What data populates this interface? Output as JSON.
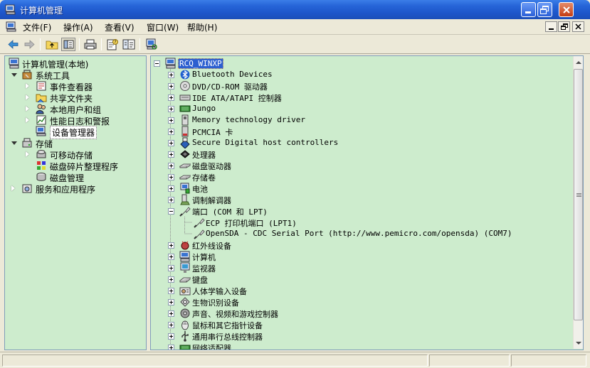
{
  "window": {
    "title": "计算机管理"
  },
  "menu": [
    "文件(F)",
    "操作(A)",
    "查看(V)",
    "窗口(W)",
    "帮助(H)"
  ],
  "left_tree": [
    {
      "label": "计算机管理(本地)"
    },
    {
      "label": "系统工具"
    },
    {
      "label": "事件查看器"
    },
    {
      "label": "共享文件夹"
    },
    {
      "label": "本地用户和组"
    },
    {
      "label": "性能日志和警报"
    },
    {
      "label": "设备管理器"
    },
    {
      "label": "存储"
    },
    {
      "label": "可移动存储"
    },
    {
      "label": "磁盘碎片整理程序"
    },
    {
      "label": "磁盘管理"
    },
    {
      "label": "服务和应用程序"
    }
  ],
  "right_tree": [
    {
      "label": "RCQ_WINXP"
    },
    {
      "label": "Bluetooth Devices"
    },
    {
      "label": "DVD/CD-ROM 驱动器"
    },
    {
      "label": "IDE ATA/ATAPI 控制器"
    },
    {
      "label": "Jungo"
    },
    {
      "label": "Memory technology driver"
    },
    {
      "label": "PCMCIA 卡"
    },
    {
      "label": "Secure Digital host controllers"
    },
    {
      "label": "处理器"
    },
    {
      "label": "磁盘驱动器"
    },
    {
      "label": "存储卷"
    },
    {
      "label": "电池"
    },
    {
      "label": "调制解调器"
    },
    {
      "label": "端口 (COM 和 LPT)"
    },
    {
      "label": "ECP 打印机端口 (LPT1)"
    },
    {
      "label": "OpenSDA - CDC Serial Port (http://www.pemicro.com/opensda) (COM7)"
    },
    {
      "label": "红外线设备"
    },
    {
      "label": "计算机"
    },
    {
      "label": "监视器"
    },
    {
      "label": "键盘"
    },
    {
      "label": "人体学输入设备"
    },
    {
      "label": "生物识别设备"
    },
    {
      "label": "声音、视频和游戏控制器"
    },
    {
      "label": "鼠标和其它指针设备"
    },
    {
      "label": "通用串行总线控制器"
    },
    {
      "label": "网络适配器"
    }
  ],
  "colors": {
    "pane_background": "#cdeccd",
    "titlebar": "#2665d8",
    "selection": "#2c5fd0"
  }
}
